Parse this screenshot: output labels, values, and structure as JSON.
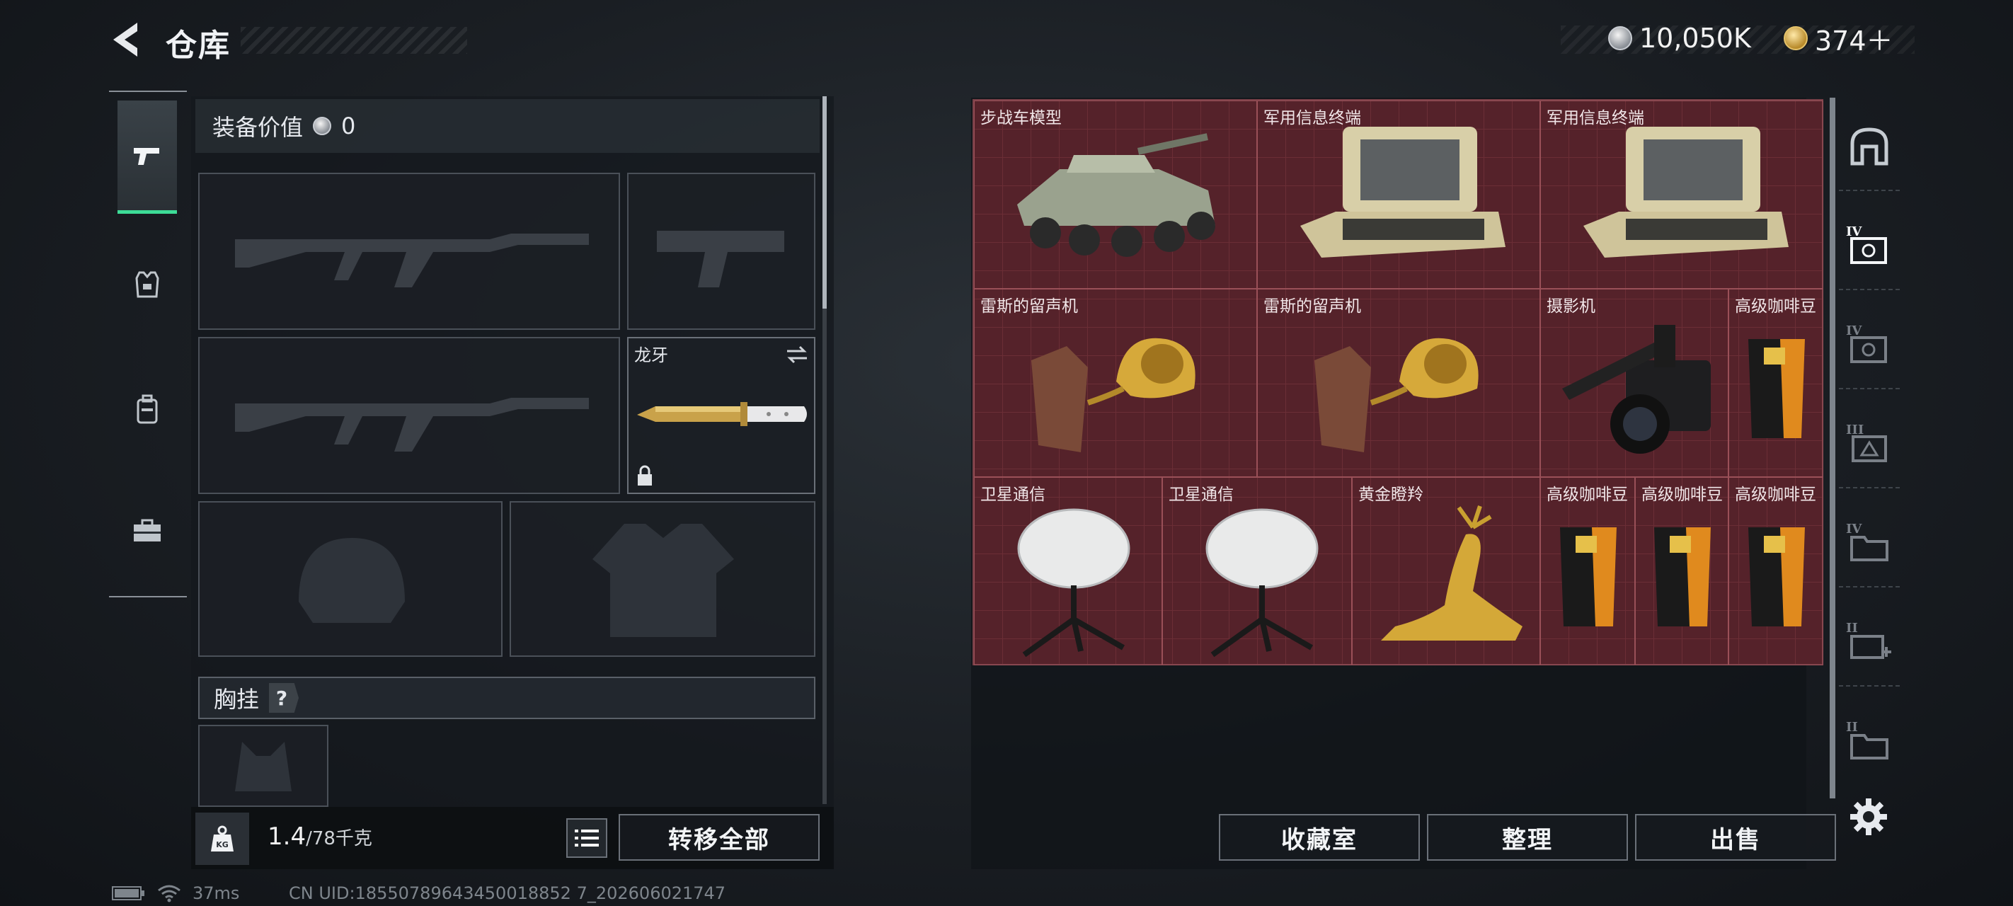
{
  "header": {
    "title": "仓库",
    "currency_silver": "10,050K",
    "currency_gold": "374＋"
  },
  "left_rail": {
    "items": [
      {
        "name": "weapons",
        "icon": "pistol-icon",
        "active": true
      },
      {
        "name": "armor",
        "icon": "vest-icon",
        "active": false
      },
      {
        "name": "backpack",
        "icon": "backpack-icon",
        "active": false
      },
      {
        "name": "toolbox",
        "icon": "toolbox-icon",
        "active": false
      }
    ]
  },
  "equipment": {
    "value_label": "装备价值",
    "value": "0",
    "knife_name": "龙牙",
    "chest_rig_label": "胸挂",
    "help": "?",
    "weight_current": "1.4",
    "weight_max": "/78千克",
    "transfer_all_label": "转移全部"
  },
  "stash": {
    "items": [
      {
        "label": "步战车模型",
        "icon": "ifv-model-icon"
      },
      {
        "label": "军用信息终端",
        "icon": "military-terminal-icon"
      },
      {
        "label": "军用信息终端",
        "icon": "military-terminal-icon"
      },
      {
        "label": "雷斯的留声机",
        "icon": "gramophone-icon"
      },
      {
        "label": "雷斯的留声机",
        "icon": "gramophone-icon"
      },
      {
        "label": "摄影机",
        "icon": "camera-icon"
      },
      {
        "label": "高级咖啡豆",
        "icon": "coffee-bag-icon"
      },
      {
        "label": "卫星通信",
        "icon": "satellite-dish-icon"
      },
      {
        "label": "卫星通信",
        "icon": "satellite-dish-icon"
      },
      {
        "label": "黄金瞪羚",
        "icon": "golden-gazelle-icon"
      },
      {
        "label": "高级咖啡豆",
        "icon": "coffee-bag-icon"
      },
      {
        "label": "高级咖啡豆",
        "icon": "coffee-bag-icon"
      },
      {
        "label": "高级咖啡豆",
        "icon": "coffee-bag-icon"
      }
    ],
    "collection_label": "收藏室",
    "sort_label": "整理",
    "sell_label": "出售"
  },
  "right_rail": {
    "tiers": [
      "IV",
      "IV",
      "III",
      "IV",
      "II",
      "II"
    ]
  },
  "status": {
    "ping": "37ms",
    "uid": "CN UID:18550789643450018852 7_202606021747"
  },
  "colors": {
    "accent_green": "#3ddc97",
    "stash_red": "#55222a"
  }
}
